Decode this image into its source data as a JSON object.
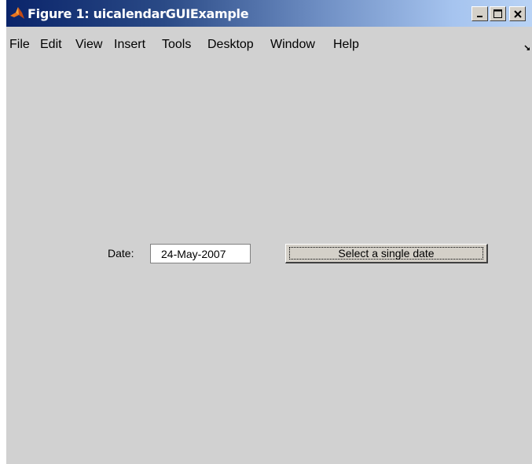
{
  "window": {
    "title": "Figure 1: uicalendarGUIExample",
    "controls": {
      "minimize": "_",
      "maximize": "□",
      "close": "×"
    }
  },
  "menubar": {
    "items": [
      "File",
      "Edit",
      "View",
      "Insert",
      "Tools",
      "Desktop",
      "Window",
      "Help"
    ]
  },
  "form": {
    "date_label": "Date:",
    "date_value": "24-May-2007",
    "select_button_label": "Select a single date"
  },
  "colors": {
    "figure_background": "#d1d1d1",
    "titlebar_start": "#0a246a",
    "titlebar_end": "#b9d3f5"
  },
  "icons": {
    "app": "matlab-logo-icon",
    "menu_overflow": "dock-arrow-icon"
  }
}
